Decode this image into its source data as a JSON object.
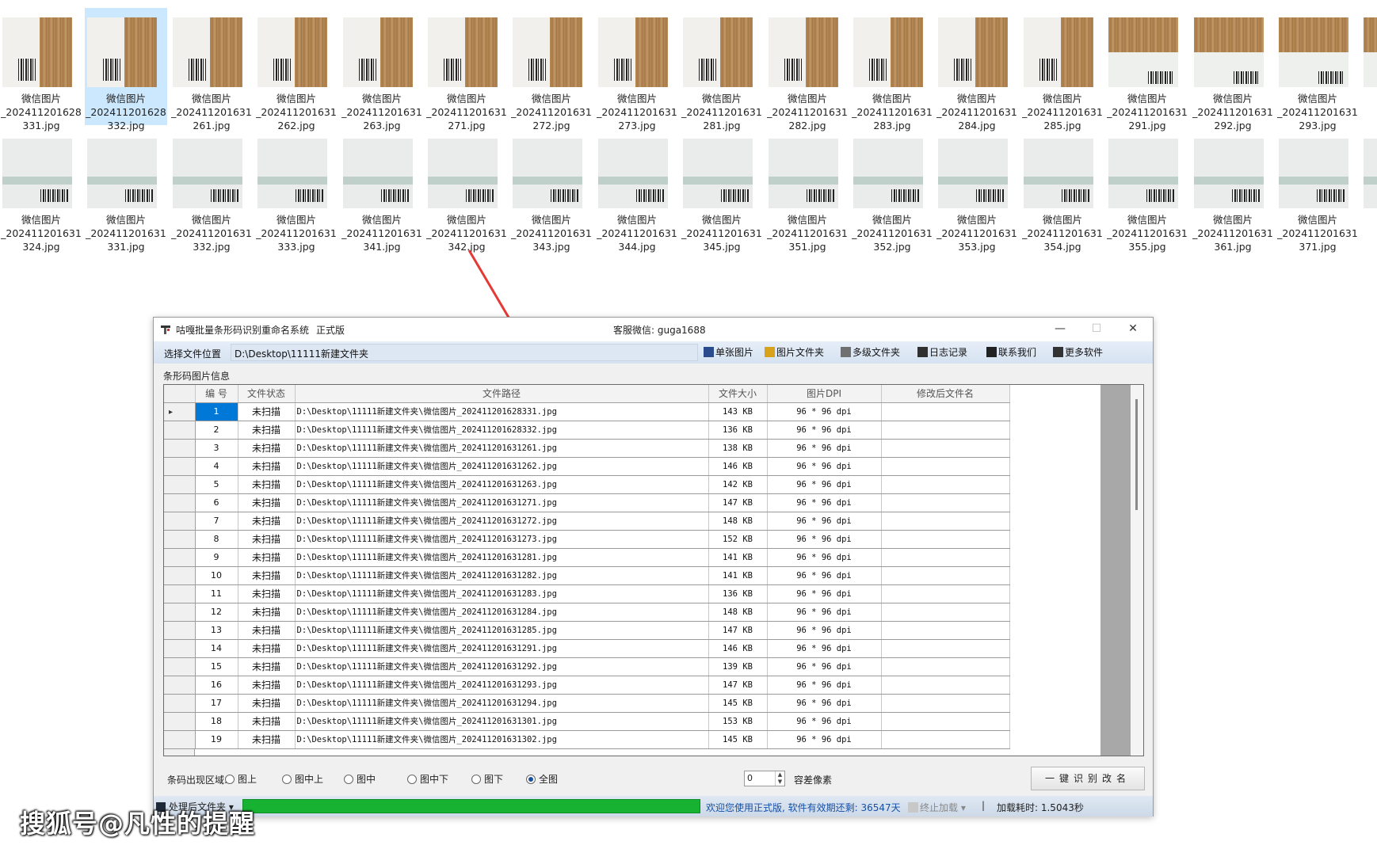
{
  "thumbnails_row1": [
    {
      "name": [
        "微信图片",
        "_202411201628",
        "331.jpg"
      ],
      "kind": "A",
      "selected": false
    },
    {
      "name": [
        "微信图片",
        "_202411201628",
        "332.jpg"
      ],
      "kind": "A",
      "selected": true
    },
    {
      "name": [
        "微信图片",
        "_202411201631",
        "261.jpg"
      ],
      "kind": "A",
      "selected": false
    },
    {
      "name": [
        "微信图片",
        "_202411201631",
        "262.jpg"
      ],
      "kind": "A",
      "selected": false
    },
    {
      "name": [
        "微信图片",
        "_202411201631",
        "263.jpg"
      ],
      "kind": "A",
      "selected": false
    },
    {
      "name": [
        "微信图片",
        "_202411201631",
        "271.jpg"
      ],
      "kind": "A",
      "selected": false
    },
    {
      "name": [
        "微信图片",
        "_202411201631",
        "272.jpg"
      ],
      "kind": "A",
      "selected": false
    },
    {
      "name": [
        "微信图片",
        "_202411201631",
        "273.jpg"
      ],
      "kind": "A",
      "selected": false
    },
    {
      "name": [
        "微信图片",
        "_202411201631",
        "281.jpg"
      ],
      "kind": "A",
      "selected": false
    },
    {
      "name": [
        "微信图片",
        "_202411201631",
        "282.jpg"
      ],
      "kind": "A",
      "selected": false
    },
    {
      "name": [
        "微信图片",
        "_202411201631",
        "283.jpg"
      ],
      "kind": "A",
      "selected": false
    },
    {
      "name": [
        "微信图片",
        "_202411201631",
        "284.jpg"
      ],
      "kind": "A",
      "selected": false
    },
    {
      "name": [
        "微信图片",
        "_202411201631",
        "285.jpg"
      ],
      "kind": "A",
      "selected": false
    },
    {
      "name": [
        "微信图片",
        "_202411201631",
        "291.jpg"
      ],
      "kind": "B",
      "selected": false
    },
    {
      "name": [
        "微信图片",
        "_202411201631",
        "292.jpg"
      ],
      "kind": "B",
      "selected": false
    },
    {
      "name": [
        "微信图片",
        "_202411201631",
        "293.jpg"
      ],
      "kind": "B",
      "selected": false
    },
    {
      "name": [
        "微",
        "_20",
        ""
      ],
      "kind": "B",
      "selected": false
    }
  ],
  "thumbnails_row2": [
    {
      "name": [
        "微信图片",
        "_202411201631",
        "324.jpg"
      ],
      "kind": "C"
    },
    {
      "name": [
        "微信图片",
        "_202411201631",
        "331.jpg"
      ],
      "kind": "C"
    },
    {
      "name": [
        "微信图片",
        "_202411201631",
        "332.jpg"
      ],
      "kind": "C"
    },
    {
      "name": [
        "微信图片",
        "_202411201631",
        "333.jpg"
      ],
      "kind": "C"
    },
    {
      "name": [
        "微信图片",
        "_202411201631",
        "341.jpg"
      ],
      "kind": "C"
    },
    {
      "name": [
        "微信图片",
        "_202411201631",
        "342.jpg"
      ],
      "kind": "C"
    },
    {
      "name": [
        "微信图片",
        "_202411201631",
        "343.jpg"
      ],
      "kind": "C"
    },
    {
      "name": [
        "微信图片",
        "_202411201631",
        "344.jpg"
      ],
      "kind": "C"
    },
    {
      "name": [
        "微信图片",
        "_202411201631",
        "345.jpg"
      ],
      "kind": "C"
    },
    {
      "name": [
        "微信图片",
        "_202411201631",
        "351.jpg"
      ],
      "kind": "C"
    },
    {
      "name": [
        "微信图片",
        "_202411201631",
        "352.jpg"
      ],
      "kind": "C"
    },
    {
      "name": [
        "微信图片",
        "_202411201631",
        "353.jpg"
      ],
      "kind": "C"
    },
    {
      "name": [
        "微信图片",
        "_202411201631",
        "354.jpg"
      ],
      "kind": "C"
    },
    {
      "name": [
        "微信图片",
        "_202411201631",
        "355.jpg"
      ],
      "kind": "C"
    },
    {
      "name": [
        "微信图片",
        "_202411201631",
        "361.jpg"
      ],
      "kind": "C"
    },
    {
      "name": [
        "微信图片",
        "_202411201631",
        "371.jpg"
      ],
      "kind": "C"
    },
    {
      "name": [
        "微",
        "_20",
        ""
      ],
      "kind": "C"
    }
  ],
  "window": {
    "title": "咕嘎批量条形码识别重命名系统",
    "edition": "正式版",
    "service": "客服微信: guga1688",
    "minimize": "—",
    "maximize": "☐",
    "close": "✕"
  },
  "toolbar": {
    "select_location_label": "选择文件位置",
    "path_value": "D:\\Desktop\\11111新建文件夹",
    "buttons": [
      {
        "label": "单张图片",
        "icon": "image-icon",
        "color": "#2b4c8c"
      },
      {
        "label": "图片文件夹",
        "icon": "folder-image-icon",
        "color": "#d8a21a"
      },
      {
        "label": "多级文件夹",
        "icon": "multi-folder-icon",
        "color": "#707070"
      },
      {
        "label": "日志记录",
        "icon": "log-icon",
        "color": "#303030"
      },
      {
        "label": "联系我们",
        "icon": "qq-icon",
        "color": "#222222"
      },
      {
        "label": "更多软件",
        "icon": "grid-icon",
        "color": "#333333"
      }
    ]
  },
  "grid": {
    "group_label": "条形码图片信息",
    "columns": [
      "编 号",
      "文件状态",
      "文件路径",
      "文件大小",
      "图片DPI",
      "修改后文件名"
    ],
    "rows": [
      {
        "no": "1",
        "status": "未扫描",
        "path": "D:\\Desktop\\11111新建文件夹\\微信图片_202411201628331.jpg",
        "size": "143 KB",
        "dpi": "96 * 96 dpi",
        "newname": ""
      },
      {
        "no": "2",
        "status": "未扫描",
        "path": "D:\\Desktop\\11111新建文件夹\\微信图片_202411201628332.jpg",
        "size": "136 KB",
        "dpi": "96 * 96 dpi",
        "newname": ""
      },
      {
        "no": "3",
        "status": "未扫描",
        "path": "D:\\Desktop\\11111新建文件夹\\微信图片_202411201631261.jpg",
        "size": "138 KB",
        "dpi": "96 * 96 dpi",
        "newname": ""
      },
      {
        "no": "4",
        "status": "未扫描",
        "path": "D:\\Desktop\\11111新建文件夹\\微信图片_202411201631262.jpg",
        "size": "146 KB",
        "dpi": "96 * 96 dpi",
        "newname": ""
      },
      {
        "no": "5",
        "status": "未扫描",
        "path": "D:\\Desktop\\11111新建文件夹\\微信图片_202411201631263.jpg",
        "size": "142 KB",
        "dpi": "96 * 96 dpi",
        "newname": ""
      },
      {
        "no": "6",
        "status": "未扫描",
        "path": "D:\\Desktop\\11111新建文件夹\\微信图片_202411201631271.jpg",
        "size": "147 KB",
        "dpi": "96 * 96 dpi",
        "newname": ""
      },
      {
        "no": "7",
        "status": "未扫描",
        "path": "D:\\Desktop\\11111新建文件夹\\微信图片_202411201631272.jpg",
        "size": "148 KB",
        "dpi": "96 * 96 dpi",
        "newname": ""
      },
      {
        "no": "8",
        "status": "未扫描",
        "path": "D:\\Desktop\\11111新建文件夹\\微信图片_202411201631273.jpg",
        "size": "152 KB",
        "dpi": "96 * 96 dpi",
        "newname": ""
      },
      {
        "no": "9",
        "status": "未扫描",
        "path": "D:\\Desktop\\11111新建文件夹\\微信图片_202411201631281.jpg",
        "size": "141 KB",
        "dpi": "96 * 96 dpi",
        "newname": ""
      },
      {
        "no": "10",
        "status": "未扫描",
        "path": "D:\\Desktop\\11111新建文件夹\\微信图片_202411201631282.jpg",
        "size": "141 KB",
        "dpi": "96 * 96 dpi",
        "newname": ""
      },
      {
        "no": "11",
        "status": "未扫描",
        "path": "D:\\Desktop\\11111新建文件夹\\微信图片_202411201631283.jpg",
        "size": "136 KB",
        "dpi": "96 * 96 dpi",
        "newname": ""
      },
      {
        "no": "12",
        "status": "未扫描",
        "path": "D:\\Desktop\\11111新建文件夹\\微信图片_202411201631284.jpg",
        "size": "148 KB",
        "dpi": "96 * 96 dpi",
        "newname": ""
      },
      {
        "no": "13",
        "status": "未扫描",
        "path": "D:\\Desktop\\11111新建文件夹\\微信图片_202411201631285.jpg",
        "size": "147 KB",
        "dpi": "96 * 96 dpi",
        "newname": ""
      },
      {
        "no": "14",
        "status": "未扫描",
        "path": "D:\\Desktop\\11111新建文件夹\\微信图片_202411201631291.jpg",
        "size": "146 KB",
        "dpi": "96 * 96 dpi",
        "newname": ""
      },
      {
        "no": "15",
        "status": "未扫描",
        "path": "D:\\Desktop\\11111新建文件夹\\微信图片_202411201631292.jpg",
        "size": "139 KB",
        "dpi": "96 * 96 dpi",
        "newname": ""
      },
      {
        "no": "16",
        "status": "未扫描",
        "path": "D:\\Desktop\\11111新建文件夹\\微信图片_202411201631293.jpg",
        "size": "147 KB",
        "dpi": "96 * 96 dpi",
        "newname": ""
      },
      {
        "no": "17",
        "status": "未扫描",
        "path": "D:\\Desktop\\11111新建文件夹\\微信图片_202411201631294.jpg",
        "size": "145 KB",
        "dpi": "96 * 96 dpi",
        "newname": ""
      },
      {
        "no": "18",
        "status": "未扫描",
        "path": "D:\\Desktop\\11111新建文件夹\\微信图片_202411201631301.jpg",
        "size": "153 KB",
        "dpi": "96 * 96 dpi",
        "newname": ""
      },
      {
        "no": "19",
        "status": "未扫描",
        "path": "D:\\Desktop\\11111新建文件夹\\微信图片_202411201631302.jpg",
        "size": "145 KB",
        "dpi": "96 * 96 dpi",
        "newname": ""
      }
    ]
  },
  "options": {
    "region_label": "条码出现区域:",
    "regions": [
      {
        "label": "图上",
        "checked": false
      },
      {
        "label": "图中上",
        "checked": false
      },
      {
        "label": "图中",
        "checked": false
      },
      {
        "label": "图中下",
        "checked": false
      },
      {
        "label": "图下",
        "checked": false
      },
      {
        "label": "全图",
        "checked": true
      }
    ],
    "tolerance_value": "0",
    "tolerance_label": "容差像素",
    "one_key_button": "一键识别改名"
  },
  "status": {
    "process_folder_label": "处理后文件夹",
    "progress_fraction": 1.0,
    "progress_color": "#17b232",
    "welcome": "欢迎您使用正式版, 软件有效期还剩: 36547天",
    "stop_label": "终止加载",
    "separator": "|",
    "load_time": "加载耗时: 1.5043秒"
  },
  "annotation": {
    "arrow_color": "#e53935"
  },
  "watermark": "搜狐号@凡性的提醒"
}
